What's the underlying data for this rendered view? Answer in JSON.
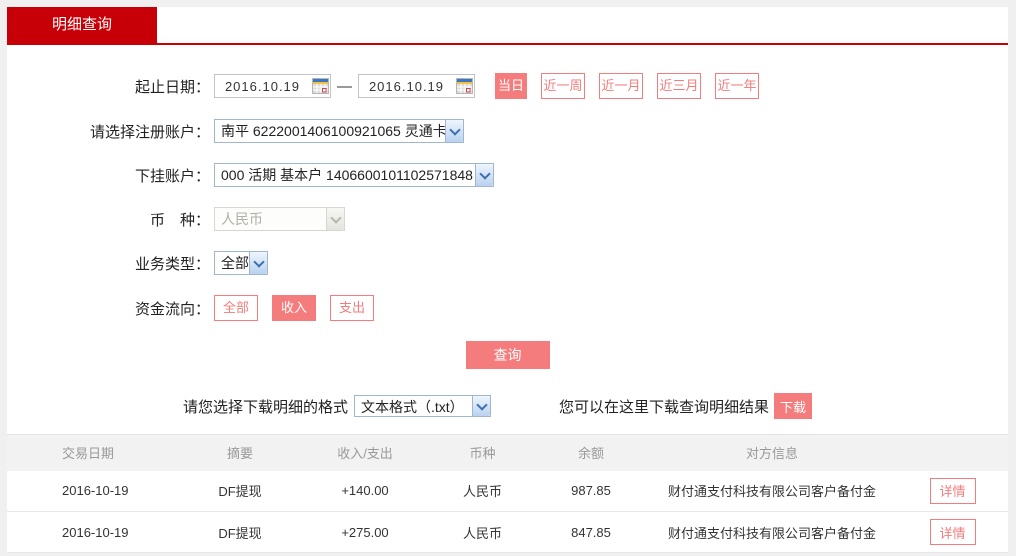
{
  "tab": {
    "label": "明细查询"
  },
  "form": {
    "date": {
      "label": "起止日期：",
      "from": "2016.10.19",
      "to": "2016.10.19",
      "separator": "—"
    },
    "period_buttons": [
      {
        "label": "当日",
        "active": true
      },
      {
        "label": "近一周",
        "active": false
      },
      {
        "label": "近一月",
        "active": false
      },
      {
        "label": "近三月",
        "active": false
      },
      {
        "label": "近一年",
        "active": false
      }
    ],
    "registered_account": {
      "label": "请选择注册账户：",
      "value": "南平 6222001406100921065 灵通卡"
    },
    "sub_account": {
      "label": "下挂账户：",
      "value": "000 活期 基本户 1406600101102571848"
    },
    "currency": {
      "label": "币　种：",
      "value": "人民币",
      "disabled": true
    },
    "business_type": {
      "label": "业务类型：",
      "value": "全部"
    },
    "fund_flow": {
      "label": "资金流向：",
      "buttons": [
        {
          "label": "全部",
          "active": false
        },
        {
          "label": "收入",
          "active": true
        },
        {
          "label": "支出",
          "active": false
        }
      ]
    },
    "query_label": "查询"
  },
  "download": {
    "format_label": "请您选择下载明细的格式",
    "format_value": "文本格式（.txt）",
    "hint": "您可以在这里下载查询明细结果",
    "button_label": "下载"
  },
  "table": {
    "headers": [
      "交易日期",
      "摘要",
      "收入/支出",
      "币种",
      "余额",
      "对方信息"
    ],
    "rows": [
      {
        "date": "2016-10-19",
        "summary": "DF提现",
        "amount": "+140.00",
        "currency": "人民币",
        "balance": "987.85",
        "counterparty": "财付通支付科技有限公司客户备付金",
        "detail_label": "详情"
      },
      {
        "date": "2016-10-19",
        "summary": "DF提现",
        "amount": "+275.00",
        "currency": "人民币",
        "balance": "847.85",
        "counterparty": "财付通支付科技有限公司客户备付金",
        "detail_label": "详情"
      }
    ]
  },
  "colors": {
    "brand_red": "#c70008",
    "salmon": "#f47c7c",
    "amount_red": "#cc0000",
    "table_header_bg": "#f2f2f2"
  }
}
